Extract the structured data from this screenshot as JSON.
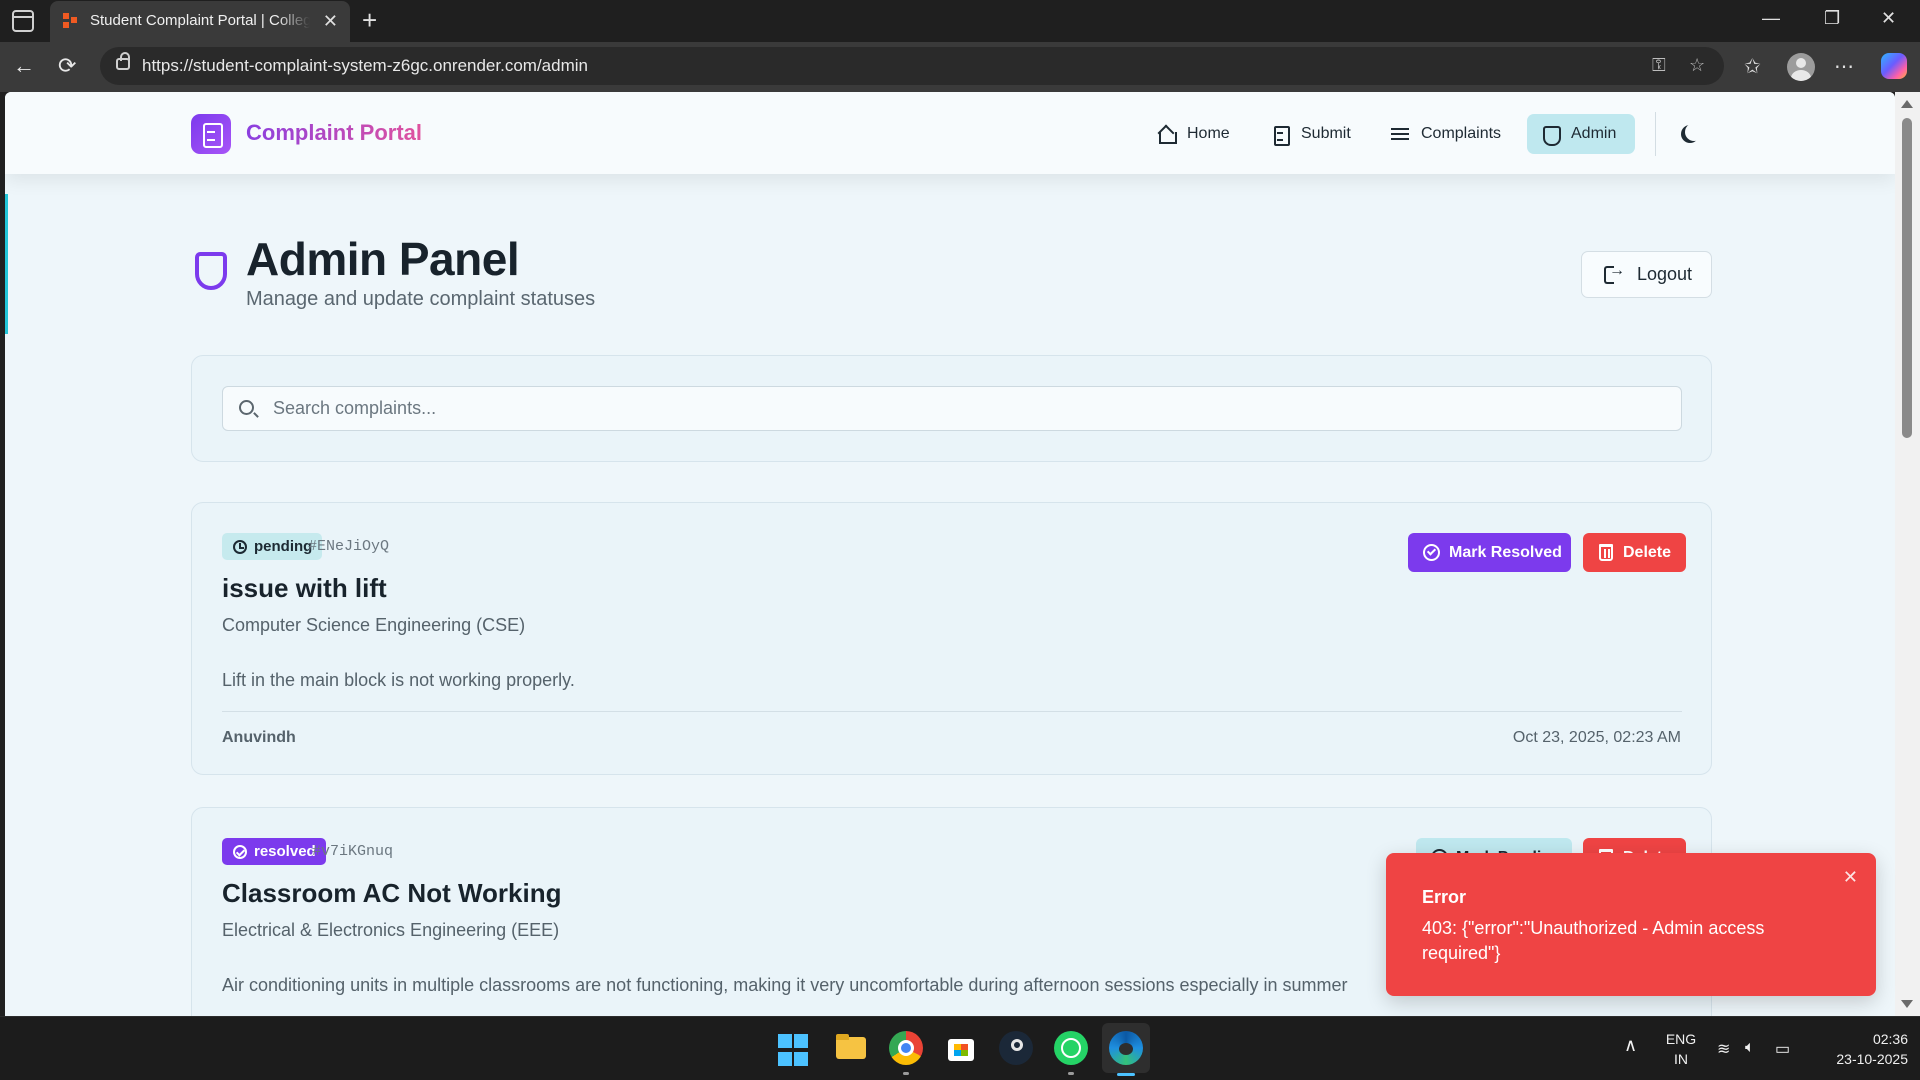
{
  "browser": {
    "tab_title": "Student Complaint Portal | College",
    "tab_close": "✕",
    "new_tab": "+",
    "url": "https://student-complaint-system-z6gc.onrender.com/admin",
    "window_controls": {
      "minimize": "—",
      "restore": "❐",
      "close": "✕"
    },
    "nav": {
      "back": "←",
      "reload": "⟳",
      "more": "⋯"
    }
  },
  "site": {
    "brand": "Complaint Portal",
    "nav": [
      {
        "label": "Home",
        "icon": "home-icon"
      },
      {
        "label": "Submit",
        "icon": "document-icon"
      },
      {
        "label": "Complaints",
        "icon": "list-icon"
      },
      {
        "label": "Admin",
        "icon": "shield-icon",
        "active": true
      }
    ],
    "theme_toggle_icon": "moon-icon"
  },
  "admin": {
    "title": "Admin Panel",
    "subtitle": "Manage and update complaint statuses",
    "logout_label": "Logout"
  },
  "search": {
    "placeholder": "Search complaints..."
  },
  "complaints": [
    {
      "status": "pending",
      "id": "#ENeJiOyQ",
      "title": "issue with lift",
      "department": "Computer Science Engineering (CSE)",
      "description": "Lift in the main block is not working properly.",
      "author": "Anuvindh",
      "date": "Oct 23, 2025, 02:23 AM",
      "primary_action": "Mark Resolved",
      "delete_action": "Delete"
    },
    {
      "status": "resolved",
      "id": "#v7iKGnuq",
      "title": "Classroom AC Not Working",
      "department": "Electrical & Electronics Engineering (EEE)",
      "description": "Air conditioning units in multiple classrooms are not functioning, making it very uncomfortable during afternoon sessions especially in summer",
      "primary_action": "Mark Pending",
      "delete_action": "Delete"
    }
  ],
  "toast": {
    "title": "Error",
    "message": "403: {\"error\":\"Unauthorized - Admin access required\"}",
    "close": "✕"
  },
  "taskbar": {
    "language": "ENG",
    "region": "IN",
    "time": "02:36",
    "date": "23-10-2025",
    "chevron": "∧"
  },
  "colors": {
    "accent_purple": "#7c3aed",
    "danger_red": "#ef4444",
    "pending_teal": "#c6eaee",
    "page_bg": "#eef6fa"
  }
}
